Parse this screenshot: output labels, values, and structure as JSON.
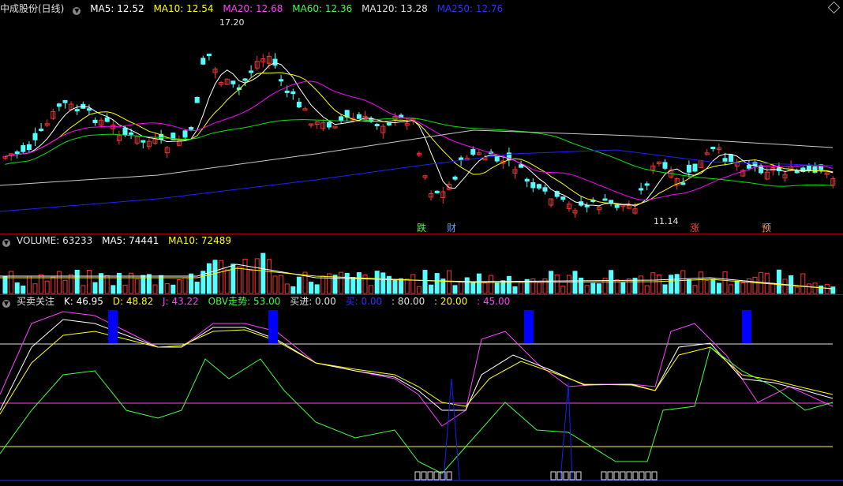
{
  "main_header": {
    "stock": "中成股份(日线)",
    "ma5": "MA5: 12.52",
    "ma10": "MA10: 12.54",
    "ma20": "MA20: 12.68",
    "ma60": "MA60: 12.36",
    "ma120": "MA120: 13.28",
    "ma250": "MA250: 12.76"
  },
  "vol_header": {
    "volume": "VOLUME: 63233",
    "ma5": "MA5: 74441",
    "ma10": "MA10: 72489"
  },
  "ind_header": {
    "name": "买卖关注",
    "k": "K: 46.95",
    "d": "D: 48.82",
    "j": "J: 43.22",
    "obv": "OBV走势: 53.00",
    "buy_in": "买进: 0.00",
    "buy": "买: 0.00",
    "l80": ": 80.00",
    "l20": ": 20.00",
    "l45": ": 45.00"
  },
  "annotations": {
    "high": "17.20",
    "low": "11.14"
  },
  "markers": {
    "m1": "跌",
    "m2": "财",
    "m3": "涨",
    "m4": "预"
  },
  "colors": {
    "up": "#ff3232",
    "down": "#54ffff",
    "ma5": "#ffffff",
    "ma10": "#ffff00",
    "ma20": "#ff00ff",
    "ma60": "#00e600",
    "ma120": "#c8c8c8",
    "ma250": "#2020ff"
  }
}
